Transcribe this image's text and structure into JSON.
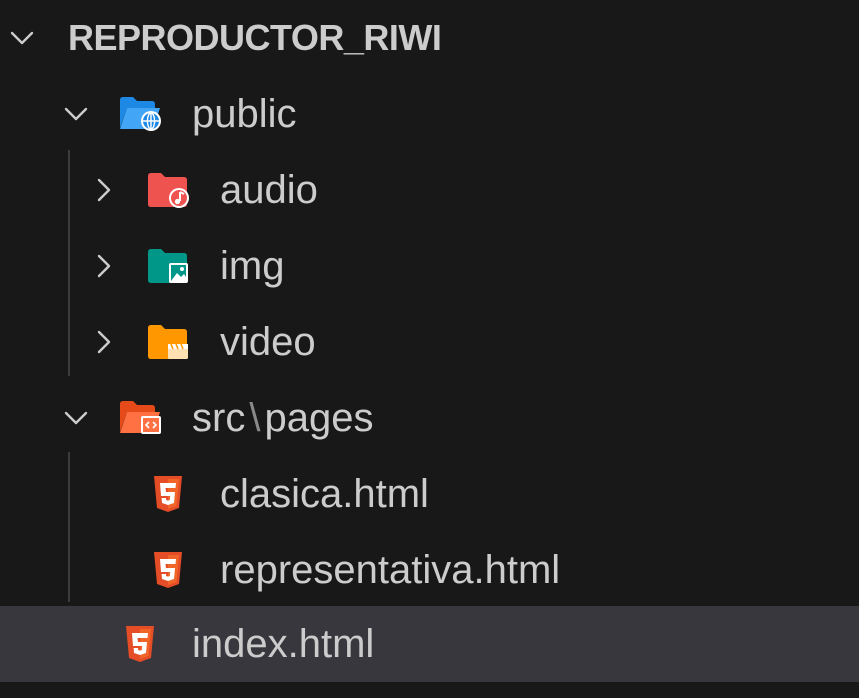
{
  "explorer": {
    "root": {
      "label": "REPRODUCTOR_RIWI",
      "expanded": true
    },
    "items": [
      {
        "id": "public",
        "label": "public",
        "type": "folder",
        "icon": "folder-public-open-icon",
        "expanded": true
      },
      {
        "id": "audio",
        "label": "audio",
        "type": "folder",
        "icon": "folder-audio-icon",
        "expanded": false
      },
      {
        "id": "img",
        "label": "img",
        "type": "folder",
        "icon": "folder-images-icon",
        "expanded": false
      },
      {
        "id": "video",
        "label": "video",
        "type": "folder",
        "icon": "folder-video-icon",
        "expanded": false
      },
      {
        "id": "src-pages",
        "label_a": "src",
        "separator": "\\",
        "label_b": "pages",
        "type": "folder",
        "icon": "folder-src-open-icon",
        "expanded": true
      },
      {
        "id": "clasica",
        "label": "clasica.html",
        "type": "file",
        "icon": "html5-icon"
      },
      {
        "id": "representativa",
        "label": "representativa.html",
        "type": "file",
        "icon": "html5-icon"
      },
      {
        "id": "index",
        "label": "index.html",
        "type": "file",
        "icon": "html5-icon",
        "selected": true
      }
    ]
  },
  "colors": {
    "background": "#181818",
    "selected_row": "#37373d",
    "text": "#cccccc",
    "folder_public": "#42a5f5",
    "folder_audio": "#ef5350",
    "folder_images": "#009688",
    "folder_video": "#ff9800",
    "folder_src": "#ff7043",
    "html5": "#e44d26"
  }
}
